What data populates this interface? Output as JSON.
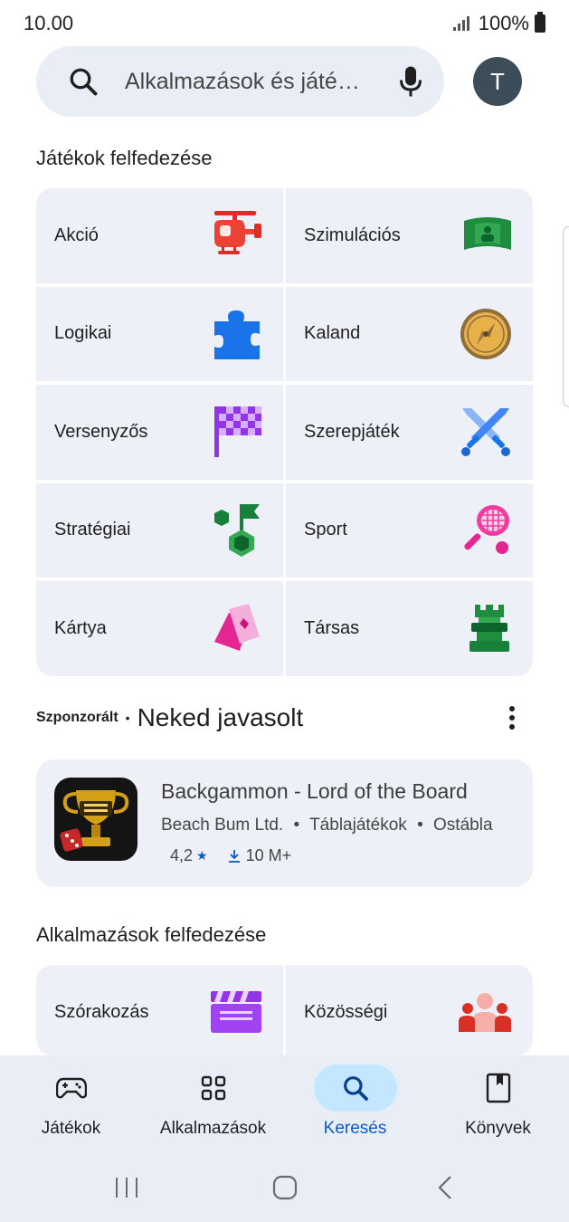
{
  "status_bar": {
    "time": "10.00",
    "battery": "100%"
  },
  "search": {
    "placeholder": "Alkalmazások és játé…"
  },
  "account": {
    "initial": "T"
  },
  "games_section": {
    "title": "Játékok felfedezése",
    "categories": [
      {
        "label": "Akció",
        "icon": "helicopter-icon"
      },
      {
        "label": "Szimulációs",
        "icon": "simulation-stage-icon"
      },
      {
        "label": "Logikai",
        "icon": "puzzle-piece-icon"
      },
      {
        "label": "Kaland",
        "icon": "compass-icon"
      },
      {
        "label": "Versenyzős",
        "icon": "checkered-flag-icon"
      },
      {
        "label": "Szerepjáték",
        "icon": "crossed-swords-icon"
      },
      {
        "label": "Stratégiai",
        "icon": "strategy-flag-icon"
      },
      {
        "label": "Sport",
        "icon": "tennis-racket-icon"
      },
      {
        "label": "Kártya",
        "icon": "playing-cards-icon"
      },
      {
        "label": "Társas",
        "icon": "chess-rook-icon"
      }
    ]
  },
  "recommended": {
    "sponsored_label": "Szponzorált",
    "separator": "•",
    "title": "Neked javasolt",
    "app": {
      "name": "Backgammon - Lord of the Board",
      "developer": "Beach Bum Ltd.",
      "category": "Táblajátékok",
      "tag": "Ostábla",
      "meta_separator": "•",
      "rating": "4,2",
      "downloads": "10 M+"
    }
  },
  "apps_section": {
    "title": "Alkalmazások felfedezése",
    "categories": [
      {
        "label": "Szórakozás",
        "icon": "clapperboard-icon"
      },
      {
        "label": "Közösségi",
        "icon": "people-group-icon"
      }
    ]
  },
  "bottom_nav": {
    "items": [
      {
        "label": "Játékok",
        "icon": "gamepad-icon",
        "active": false
      },
      {
        "label": "Alkalmazások",
        "icon": "apps-grid-icon",
        "active": false
      },
      {
        "label": "Keresés",
        "icon": "search-icon",
        "active": true
      },
      {
        "label": "Könyvek",
        "icon": "book-icon",
        "active": false
      }
    ]
  },
  "colors": {
    "accent": "#0b57d0",
    "active_pill": "#c2e7ff",
    "surface": "#edf1f7"
  }
}
